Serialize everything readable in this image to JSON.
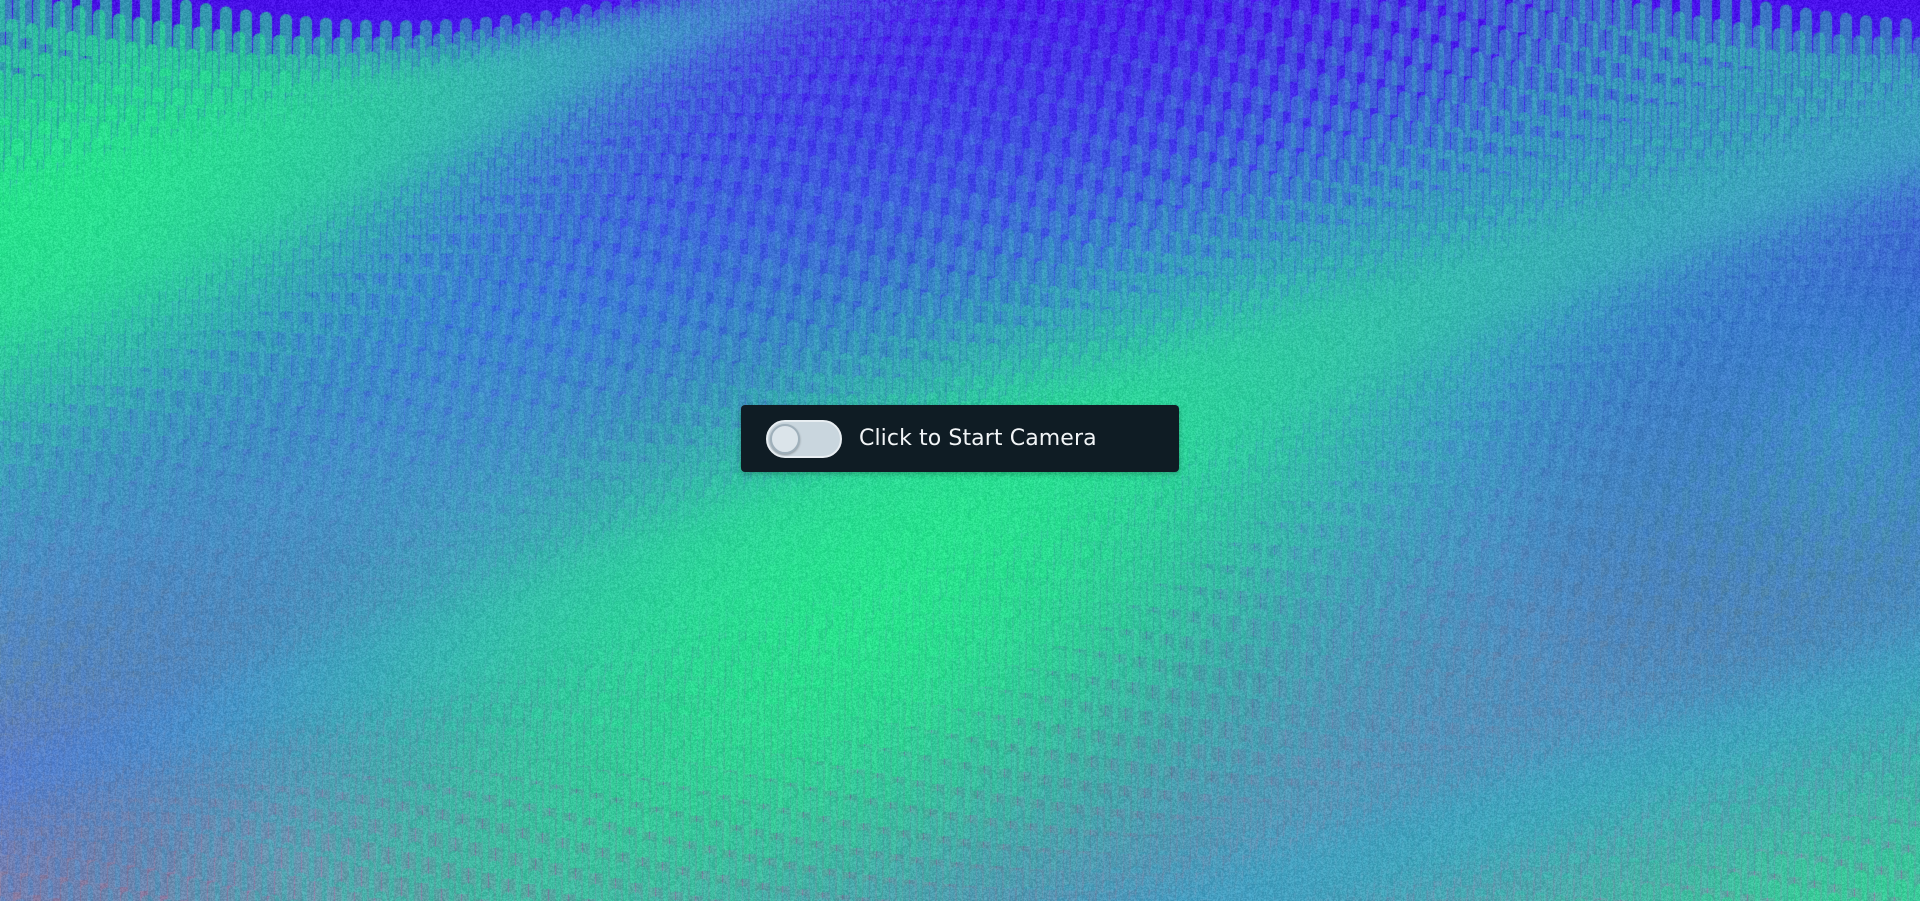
{
  "background": {
    "description_icon": "particle-wave-background",
    "colors": {
      "top": "#4a10ec",
      "middle": "#3a6fdc",
      "bottom": "#8a7fa8",
      "highlight": "#2ee59a"
    }
  },
  "camera_toggle": {
    "label": "Click to Start Camera",
    "checked": false,
    "icon": "toggle-switch-icon",
    "colors": {
      "panel": "#0f1c24",
      "track": "#c9d6de",
      "text": "#f2f5f7"
    }
  }
}
